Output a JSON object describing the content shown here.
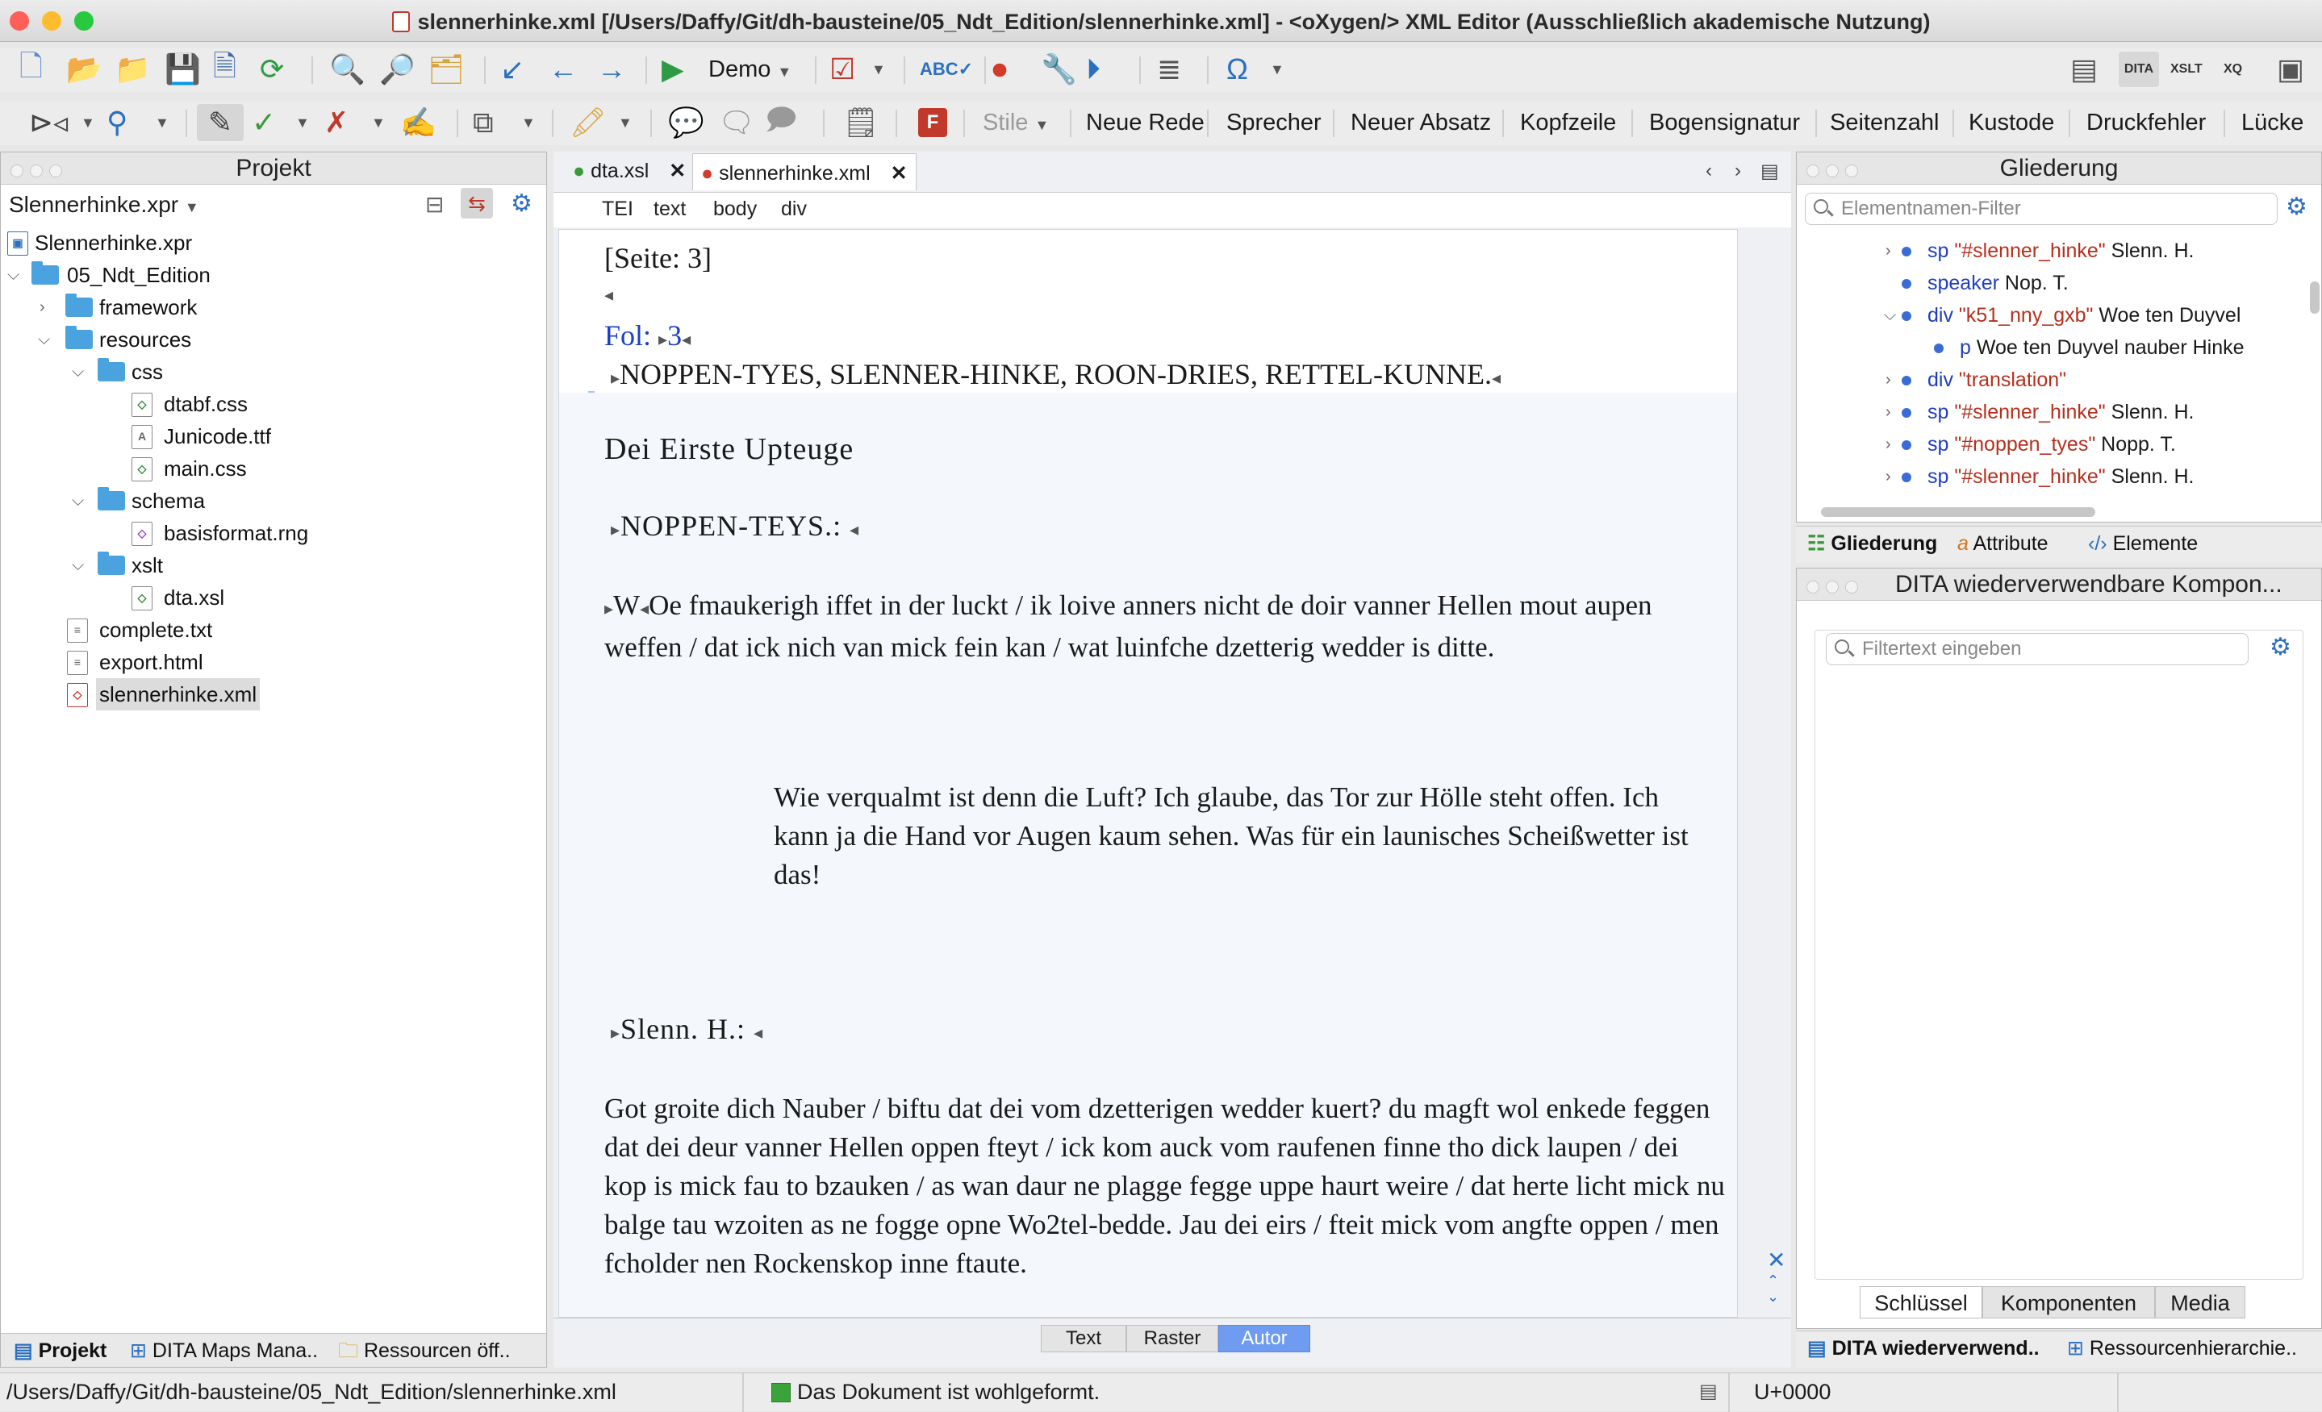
{
  "window": {
    "title": "slennerhinke.xml [/Users/Daffy/Git/dh-bausteine/05_Ndt_Edition/slennerhinke.xml] - <oXygen/> XML Editor (Ausschließlich akademische Nutzung)"
  },
  "toolbar1": {
    "transform_label": "Demo"
  },
  "toolbar2": {
    "styles_label": "Stile",
    "buttons": [
      "Neue Rede",
      "Sprecher",
      "Neuer Absatz",
      "Kopfzeile",
      "Bogensignatur",
      "Seitenzahl",
      "Kustode",
      "Druckfehler",
      "Lücke"
    ]
  },
  "project": {
    "title": "Projekt",
    "project_file_selector": "Slennerhinke.xpr",
    "tree": [
      {
        "label": "Slennerhinke.xpr",
        "icon": "project-icon"
      },
      {
        "label": "05_Ndt_Edition",
        "icon": "folder-icon"
      },
      {
        "label": "framework",
        "icon": "folder-icon"
      },
      {
        "label": "resources",
        "icon": "folder-icon"
      },
      {
        "label": "css",
        "icon": "folder-icon"
      },
      {
        "label": "dtabf.css",
        "icon": "css-file-icon"
      },
      {
        "label": "Junicode.ttf",
        "icon": "font-file-icon"
      },
      {
        "label": "main.css",
        "icon": "css-file-icon"
      },
      {
        "label": "schema",
        "icon": "folder-icon"
      },
      {
        "label": "basisformat.rng",
        "icon": "rng-file-icon"
      },
      {
        "label": "xslt",
        "icon": "folder-icon"
      },
      {
        "label": "dta.xsl",
        "icon": "xsl-file-icon"
      },
      {
        "label": "complete.txt",
        "icon": "text-file-icon"
      },
      {
        "label": "export.html",
        "icon": "html-file-icon"
      },
      {
        "label": "slennerhinke.xml",
        "icon": "xml-file-icon"
      }
    ],
    "bottom_tabs": [
      "Projekt",
      "DITA Maps Mana..",
      "Ressourcen öff.."
    ]
  },
  "editor": {
    "tabs": [
      "dta.xsl",
      "slennerhinke.xml"
    ],
    "breadcrumb": [
      "TEI",
      "text",
      "body",
      "div"
    ],
    "content": {
      "page_marker": "[Seite: 3]",
      "fol_label": "Fol:",
      "fol_number": "3",
      "cast_line": "NOPPEN-TYES, SLENNER-HINKE, ROON-DRIES, RETTEL-KUNNE.",
      "act_heading": "Dei Eirste Upteuge",
      "speaker1": "NOPPEN-TEYS.:",
      "speech1_first": "W",
      "speech1": "Oe fmaukerigh iffet in der luckt / ik loive anners nicht de doir vanner Hellen mout aupen weffen / dat ick nich van mick fein kan / wat luinfche dzetterig wedder is ditte.",
      "translation1": "Wie verqualmt ist denn die Luft? Ich glaube, das Tor zur Hölle steht offen. Ich kann ja die Hand vor Augen kaum sehen. Was für ein launisches Scheißwetter ist das!",
      "speaker2": "Slenn. H.:",
      "speech2": "Got groite dich Nauber / biftu dat dei vom dzetterigen wedder kuert? du magft wol enkede feggen dat dei deur vanner Hellen oppen fteyt / ick kom auck vom raufenen finne tho dick laupen / dei kop is mick fau to bzauken / as wan daur ne plagge fegge uppe haurt weire / dat herte licht mick nu balge tau wzoiten as ne fogge opne Wo2tel-bedde. Jau dei eirs / fteit mick vom angfte oppen / men fcholder nen Rockenskop inne ftaute."
    },
    "modes": [
      "Text",
      "Raster",
      "Autor"
    ],
    "active_mode": "Autor"
  },
  "outline": {
    "title": "Gliederung",
    "filter_placeholder": "Elementnamen-Filter",
    "rows": [
      {
        "el": "sp",
        "attr": "\"#slenner_hinke\"",
        "text": "Slenn. H."
      },
      {
        "el": "speaker",
        "attr": "",
        "text": "Nop. T."
      },
      {
        "el": "div",
        "attr": "\"k51_nny_gxb\"",
        "text": "Woe ten Duyvel"
      },
      {
        "el": "p",
        "attr": "",
        "text": "Woe ten Duyvel nauber Hinke"
      },
      {
        "el": "div",
        "attr": "\"translation\"",
        "text": ""
      },
      {
        "el": "sp",
        "attr": "\"#slenner_hinke\"",
        "text": "Slenn. H."
      },
      {
        "el": "sp",
        "attr": "\"#noppen_tyes\"",
        "text": "Nopp. T."
      },
      {
        "el": "sp",
        "attr": "\"#slenner_hinke\"",
        "text": "Slenn. H."
      }
    ],
    "tabs": [
      "Gliederung",
      "Attribute",
      "Elemente"
    ]
  },
  "dita": {
    "title": "DITA wiederverwendbare Kompon...",
    "filter_placeholder": "Filtertext eingeben",
    "segments": [
      "Schlüssel",
      "Komponenten",
      "Media"
    ],
    "bottom_tabs": [
      "DITA wiederverwend..",
      "Ressourcenhierarchie.."
    ]
  },
  "status": {
    "path": "/Users/Daffy/Git/dh-bausteine/05_Ndt_Edition/slennerhinke.xml",
    "message": "Das Dokument ist wohlgeformt.",
    "unicode": "U+0000"
  },
  "colors": {
    "accent": "#2c6fbf",
    "active_mode": "#6f9cf0",
    "element_name": "#1f3fbf",
    "attribute_value": "#b5301d"
  }
}
